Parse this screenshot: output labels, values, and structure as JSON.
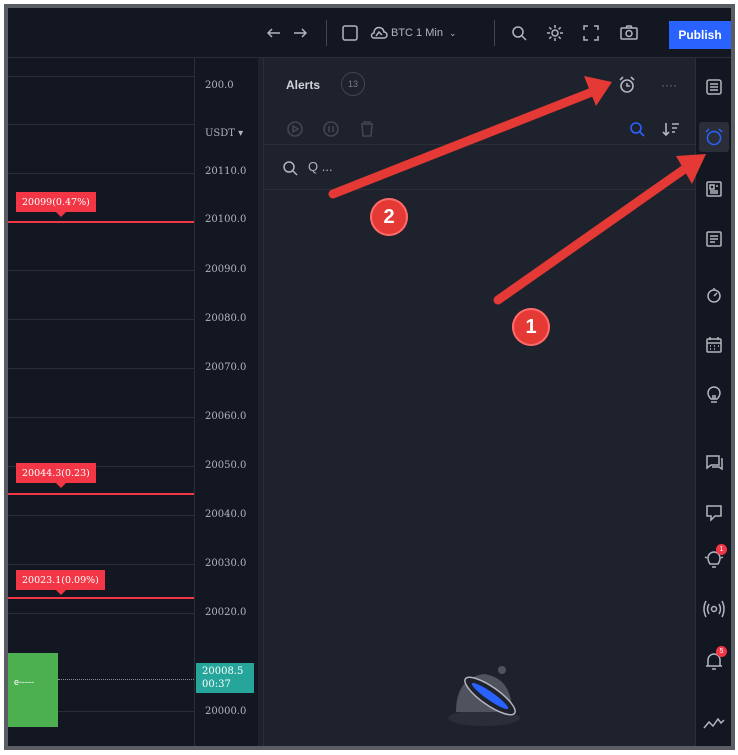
{
  "toolbar": {
    "symbol_label": "BTC 1 Min",
    "publish_label": "Publish"
  },
  "chart": {
    "currency_label": "USDT ▾",
    "price_labels": [
      "200.0",
      "20110.0",
      "20100.0",
      "20090.0",
      "20080.0",
      "20070.0",
      "20060.0",
      "20050.0",
      "20040.0",
      "20030.0",
      "20020.0",
      "20000.0"
    ],
    "alert_flags": [
      {
        "label": "20099(0.47%)"
      },
      {
        "label": "20044.3(0.23)"
      },
      {
        "label": "20023.1(0.09%)"
      }
    ],
    "last_price": "20008.5",
    "last_time": "00:37",
    "bar_label": "e-----"
  },
  "alerts_panel": {
    "title": "Alerts",
    "count": "13",
    "more_label": "····",
    "search_placeholder": "Q ..."
  },
  "sidebar": {
    "notification_badge": "1",
    "bell_badge": "5"
  },
  "annotations": {
    "marker_1": "1",
    "marker_2": "2"
  },
  "colors": {
    "accent": "#2962ff",
    "alert": "#f23645",
    "up": "#26a69a",
    "panel_bg": "#1e222d",
    "chart_bg": "#131722",
    "annotation": "#e53935"
  }
}
